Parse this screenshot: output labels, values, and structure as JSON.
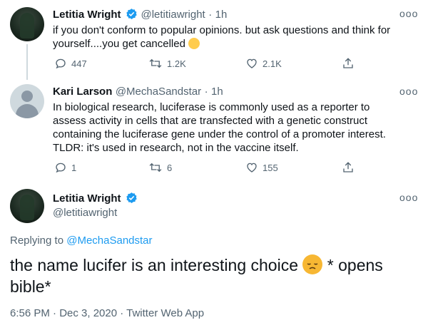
{
  "tweets": [
    {
      "name": "Letitia Wright",
      "handle": "@letitiawright",
      "sep": "·",
      "time": "1h",
      "text": "if you don't conform to popular opinions. but ask questions and think for yourself....you get cancelled",
      "emoji": "laughing-crying-emoji",
      "replies": "447",
      "retweets": "1.2K",
      "likes": "2.1K"
    },
    {
      "name": "Kari Larson",
      "handle": "@MechaSandstar",
      "sep": "·",
      "time": "1h",
      "text": "In biological research, luciferase is commonly used as a reporter to assess activity in cells that are transfected with a genetic construct containing the luciferase gene under the control of a promoter interest.  TLDR: it's used in research, not in the vaccine itself.",
      "replies": "1",
      "retweets": "6",
      "likes": "155"
    }
  ],
  "main": {
    "name": "Letitia Wright",
    "handle": "@letitiawright",
    "replying_label": "Replying to",
    "replying_handle": "@MechaSandstar",
    "text_before": "the name lucifer is an interesting choice",
    "text_after": " * opens bible*",
    "emoji": "disappointed-face-emoji",
    "footer": "6:56 PM · Dec 3, 2020 · Twitter Web App"
  },
  "more_label": "ooo",
  "colors": {
    "accent": "#1d9bf0",
    "muted": "#536471",
    "line": "#cfd9de"
  }
}
